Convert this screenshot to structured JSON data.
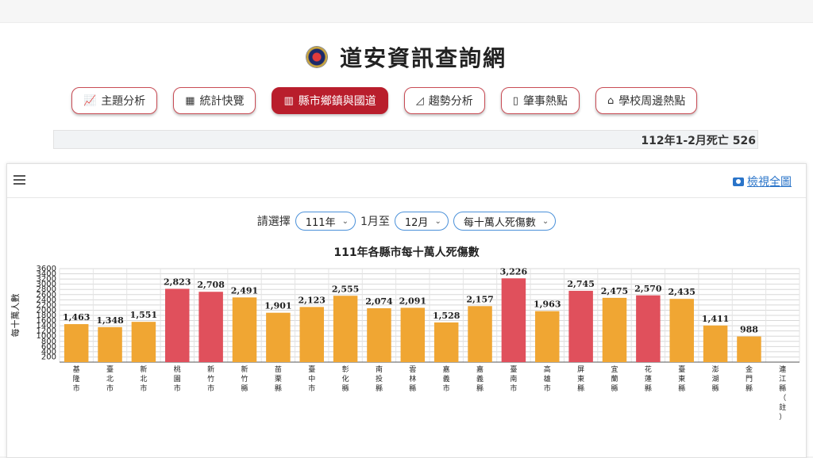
{
  "site": {
    "title": "道安資訊查詢網"
  },
  "nav": [
    {
      "icon": "line-chart-icon",
      "label": "主題分析",
      "active": false
    },
    {
      "icon": "table-icon",
      "label": "統計快覽",
      "active": false
    },
    {
      "icon": "bar-chart-icon",
      "label": "縣市鄉鎮與國道",
      "active": true
    },
    {
      "icon": "area-chart-icon",
      "label": "趨勢分析",
      "active": false
    },
    {
      "icon": "map-icon",
      "label": "肇事熱點",
      "active": false
    },
    {
      "icon": "school-icon",
      "label": "學校周邊熱點",
      "active": false
    }
  ],
  "ticker": {
    "text": "112年1-2月死亡 526"
  },
  "card": {
    "view_full_label": "檢視全圖"
  },
  "filters": {
    "prompt": "請選擇",
    "year": "111年",
    "mid_text": "1月至",
    "month": "12月",
    "metric": "每十萬人死傷數"
  },
  "chart_data": {
    "type": "bar",
    "title": "111年各縣市每十萬人死傷數",
    "ylabel": "每十萬人數",
    "xlabel": "",
    "ylim": [
      0,
      3600
    ],
    "yticks": [
      200,
      400,
      600,
      800,
      1000,
      1200,
      1400,
      1600,
      1800,
      2000,
      2200,
      2400,
      2600,
      2800,
      3000,
      3200,
      3400,
      3600
    ],
    "grid": true,
    "categories": [
      "基隆市",
      "臺北市",
      "新北市",
      "桃園市",
      "新竹市",
      "新竹縣",
      "苗栗縣",
      "臺中市",
      "彰化縣",
      "南投縣",
      "雲林縣",
      "嘉義市",
      "嘉義縣",
      "臺南市",
      "高雄市",
      "屏東縣",
      "宜蘭縣",
      "花蓮縣",
      "臺東縣",
      "澎湖縣",
      "金門縣",
      "連江縣（註）"
    ],
    "values": [
      1463,
      1348,
      1551,
      2823,
      2708,
      2491,
      1901,
      2123,
      2555,
      2074,
      2091,
      1528,
      2157,
      3226,
      1963,
      2745,
      2475,
      2570,
      2435,
      1411,
      988,
      null
    ],
    "value_labels": [
      "1,463",
      "1,348",
      "1,551",
      "2,823",
      "2,708",
      "2,491",
      "1,901",
      "2,123",
      "2,555",
      "2,074",
      "2,091",
      "1,528",
      "2,157",
      "3,226",
      "1,963",
      "2,745",
      "2,475",
      "2,570",
      "2,435",
      "1,411",
      "988",
      ""
    ],
    "highlight": [
      false,
      false,
      false,
      true,
      true,
      false,
      false,
      false,
      false,
      false,
      false,
      false,
      false,
      true,
      false,
      true,
      false,
      true,
      false,
      false,
      false,
      false
    ],
    "colors": {
      "normal": "#f0a633",
      "highlight": "#e0505c",
      "grid": "#d8d8d8",
      "axis": "#555555"
    }
  }
}
